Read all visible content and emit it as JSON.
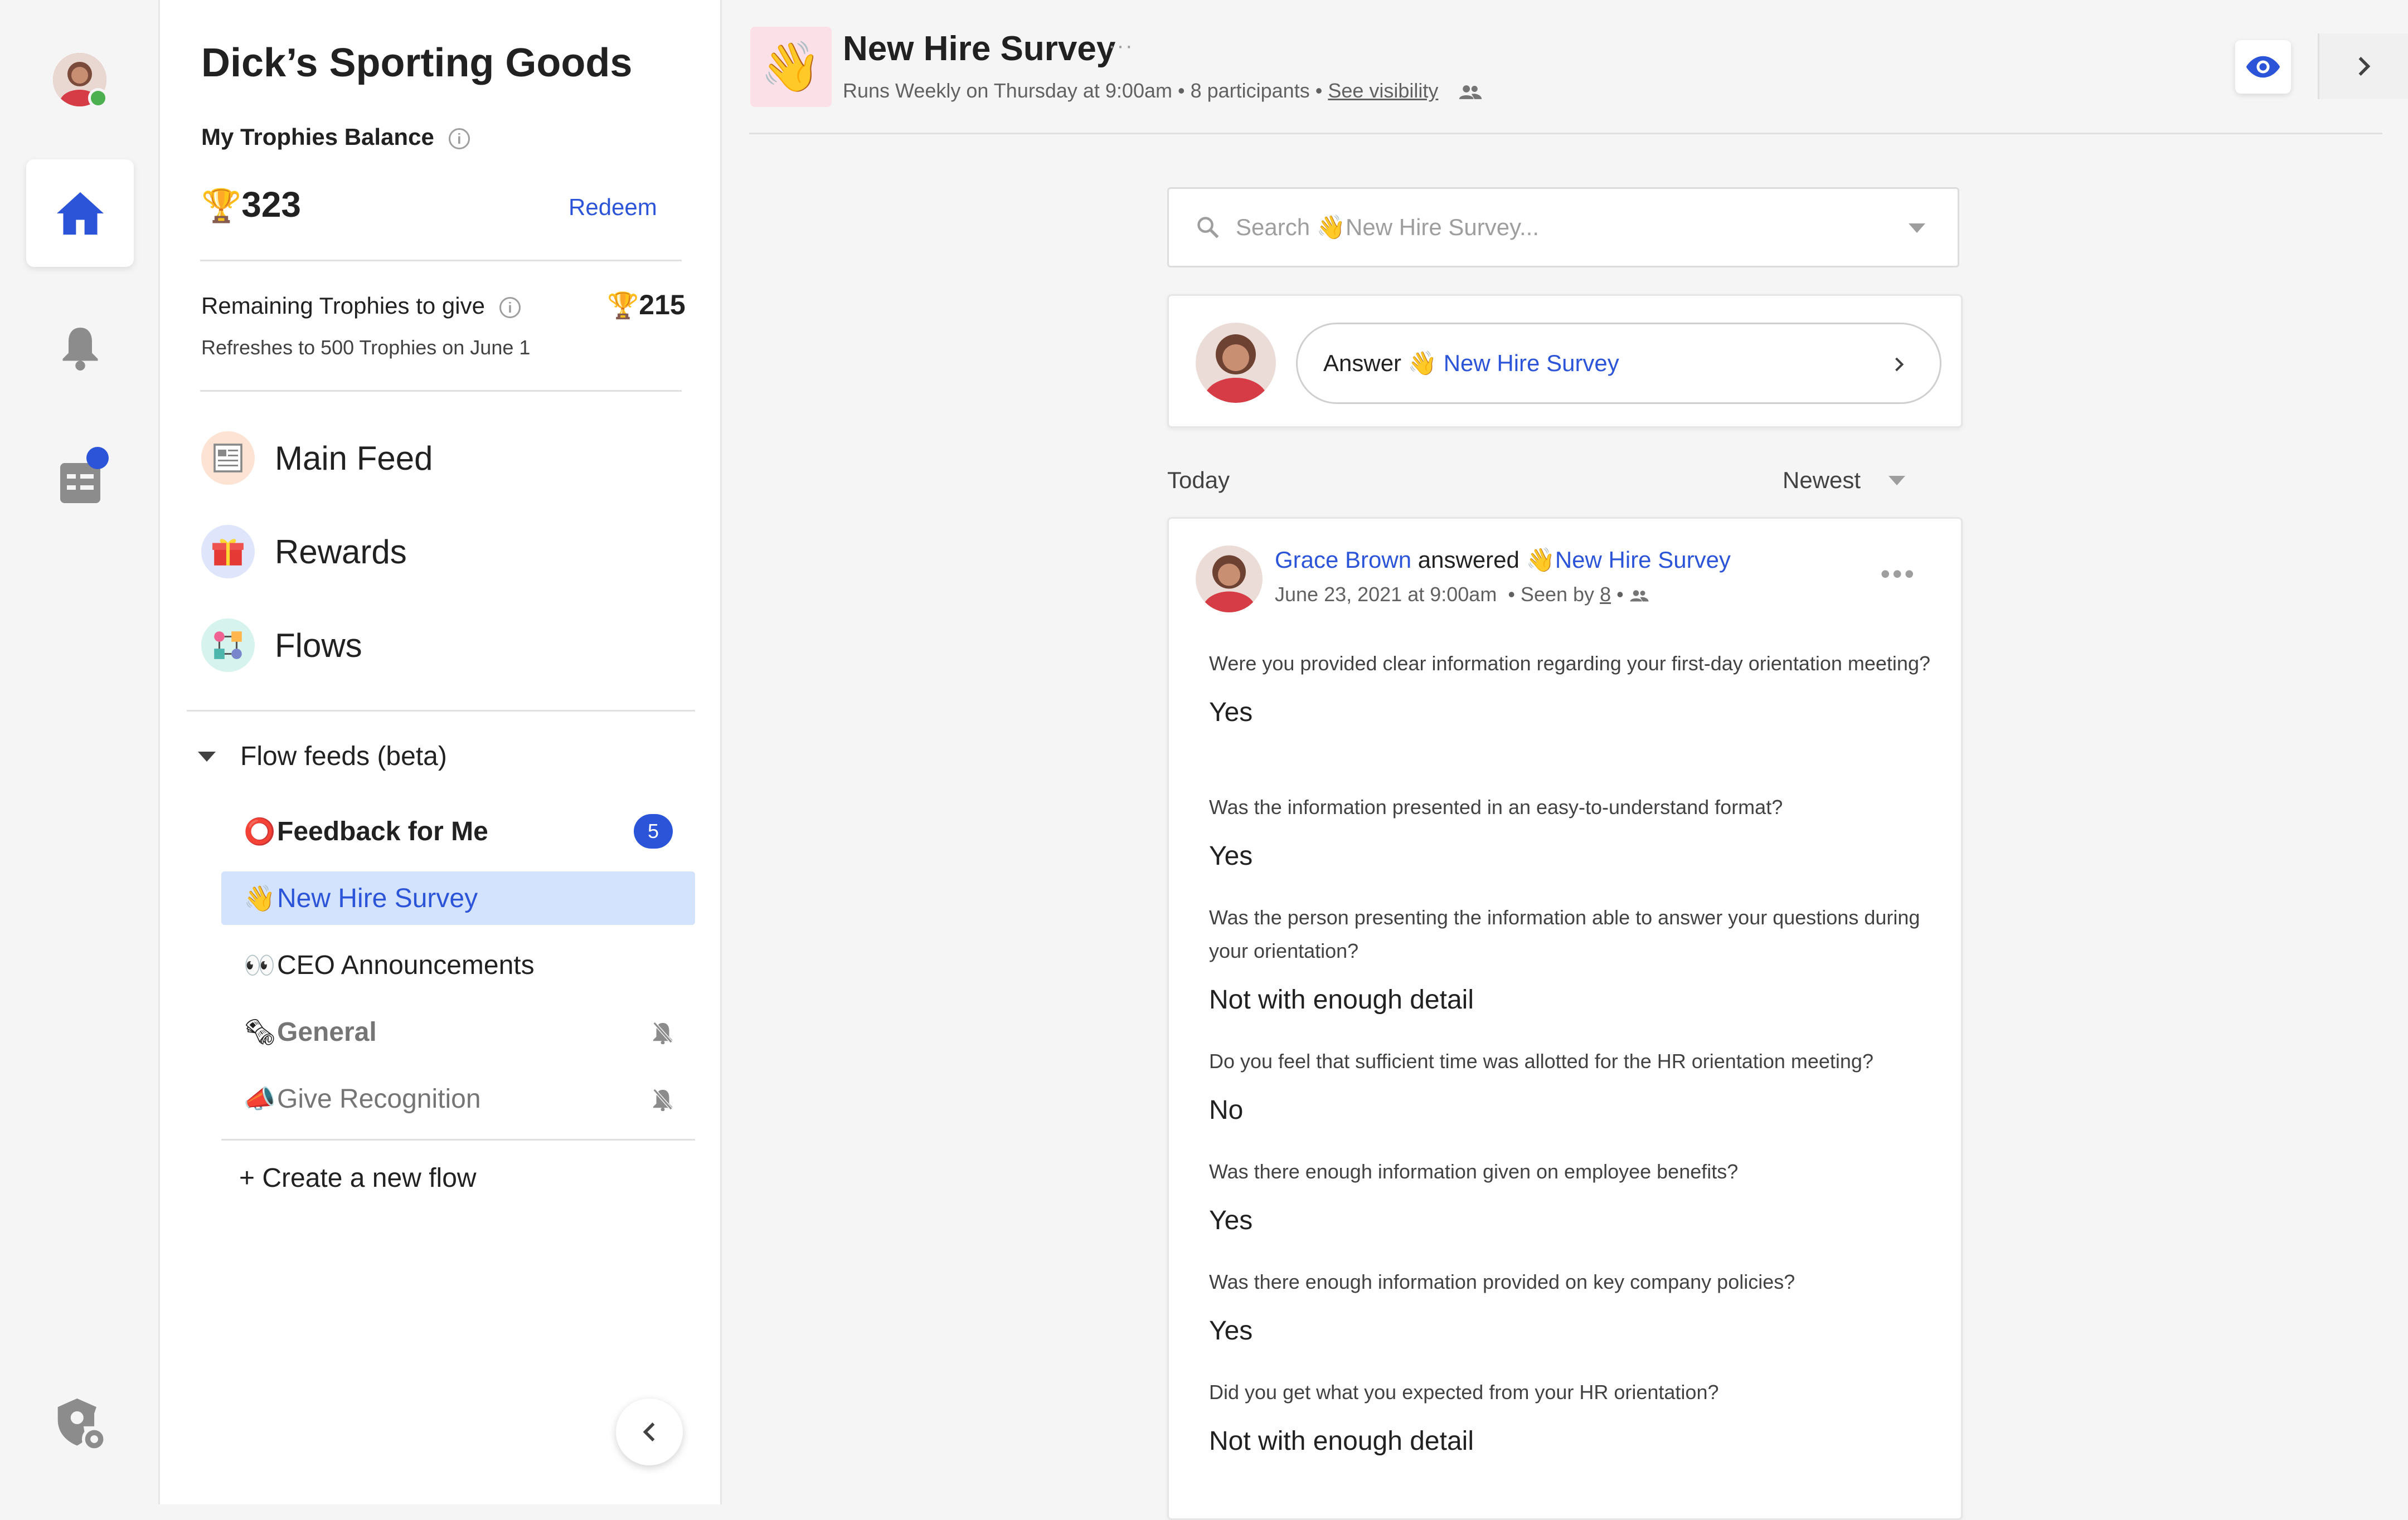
{
  "org": {
    "name": "Dick’s Sporting Goods"
  },
  "balance": {
    "label": "My Trophies Balance",
    "value": "323",
    "redeem": "Redeem",
    "remaining_label": "Remaining Trophies to give",
    "remaining_value": "215",
    "refresh_text": "Refreshes to 500 Trophies on June 1"
  },
  "nav": [
    {
      "label": "Main Feed",
      "icon": "newspaper-icon"
    },
    {
      "label": "Rewards",
      "icon": "gift-icon"
    },
    {
      "label": "Flows",
      "icon": "flows-icon"
    }
  ],
  "flow_feeds": {
    "title": "Flow feeds (beta)",
    "items": [
      {
        "emoji": "⭕",
        "label": "Feedback for Me",
        "badge": "5"
      },
      {
        "emoji": "👋",
        "label": "New Hire Survey"
      },
      {
        "emoji": "👀",
        "label": "CEO Announcements"
      },
      {
        "emoji": "🗞",
        "label": "General"
      },
      {
        "emoji": "📣",
        "label": "Give Recognition"
      }
    ],
    "create": "+ Create a new flow"
  },
  "header": {
    "emoji": "👋",
    "title": "New Hire Survey",
    "more": "···",
    "subtitle": "Runs Weekly on Thursday at 9:00am • 8 participants • ",
    "visibility": "See visibility"
  },
  "search": {
    "emoji": "👋",
    "placeholder_pre": "Search",
    "placeholder_post": "New Hire Survey..."
  },
  "answer": {
    "prefix": "Answer",
    "emoji": "👋",
    "flow": "New Hire Survey"
  },
  "feed": {
    "section": "Today",
    "sort": "Newest"
  },
  "post": {
    "author": "Grace Brown",
    "verb": "answered",
    "emoji": "👋",
    "flow": "New Hire Survey",
    "date": "June 23, 2021 at 9:00am",
    "seen_prefix": "• Seen by",
    "seen_count": "8",
    "seen_suffix": "•",
    "qa": [
      {
        "q": "Were you provided clear information regarding your first-day orientation meeting?",
        "a": "Yes"
      },
      {
        "q": "Was the information presented in an easy-to-understand format?",
        "a": "Yes"
      },
      {
        "q": "Was the person presenting the information able to answer your questions during your orientation?",
        "a": "Not with enough detail"
      },
      {
        "q": "Do you feel that sufficient time was allotted for the HR orientation meeting?",
        "a": "No"
      },
      {
        "q": "Was there enough information given on employee benefits?",
        "a": "Yes"
      },
      {
        "q": "Was there enough information provided on key company policies?",
        "a": "Yes"
      },
      {
        "q": "Did you get what you expected from your HR orientation?",
        "a": "Not with enough detail"
      }
    ]
  },
  "colors": {
    "accent": "#2b54d8",
    "active_bg": "#d3e2fd",
    "online": "#4caf50"
  }
}
